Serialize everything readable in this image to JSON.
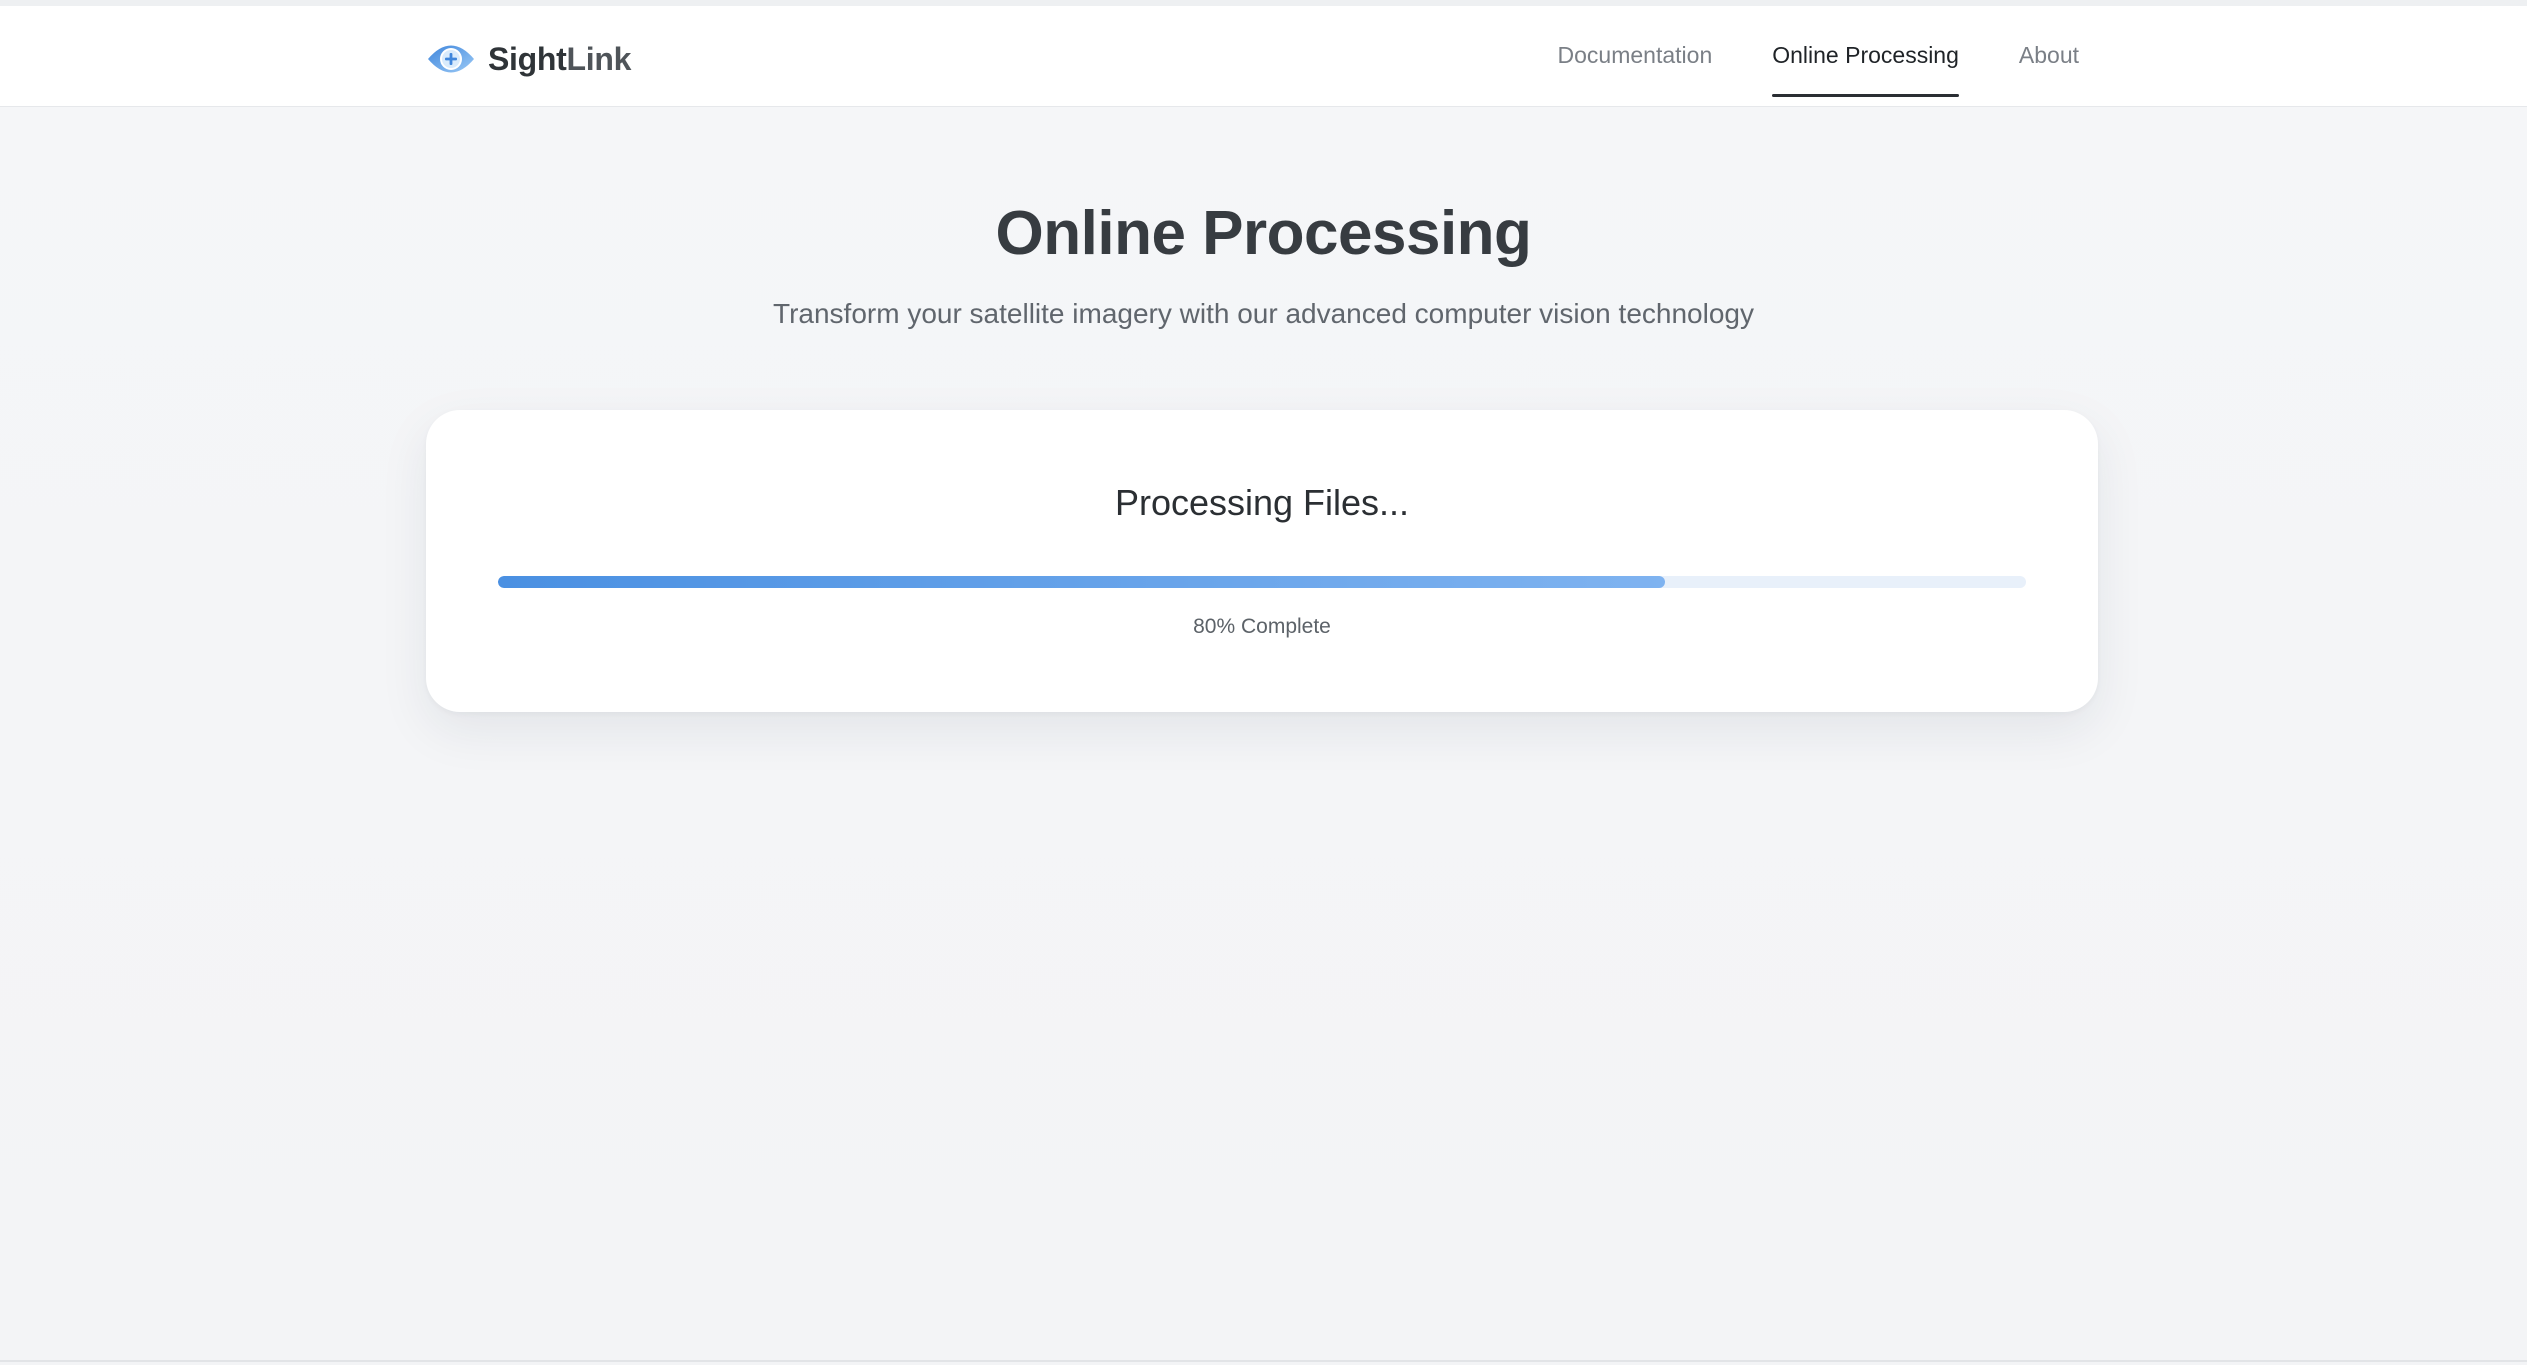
{
  "brand": {
    "name_part1": "Sight",
    "name_part2": "Link",
    "logo_icon": "eye-plus-icon",
    "logo_colors": [
      "#4a90e2",
      "#8cc0f5"
    ]
  },
  "nav": {
    "items": [
      {
        "label": "Documentation",
        "active": false
      },
      {
        "label": "Online Processing",
        "active": true
      },
      {
        "label": "About",
        "active": false
      }
    ]
  },
  "page": {
    "title": "Online Processing",
    "subtitle": "Transform your satellite imagery with our advanced computer vision technology"
  },
  "processing": {
    "title": "Processing Files...",
    "progress_percent": 80,
    "progress_label": "80% Complete",
    "bar_color_start": "#4a90e2",
    "bar_color_end": "#7fb3f0",
    "track_color": "#e8f0fa"
  }
}
